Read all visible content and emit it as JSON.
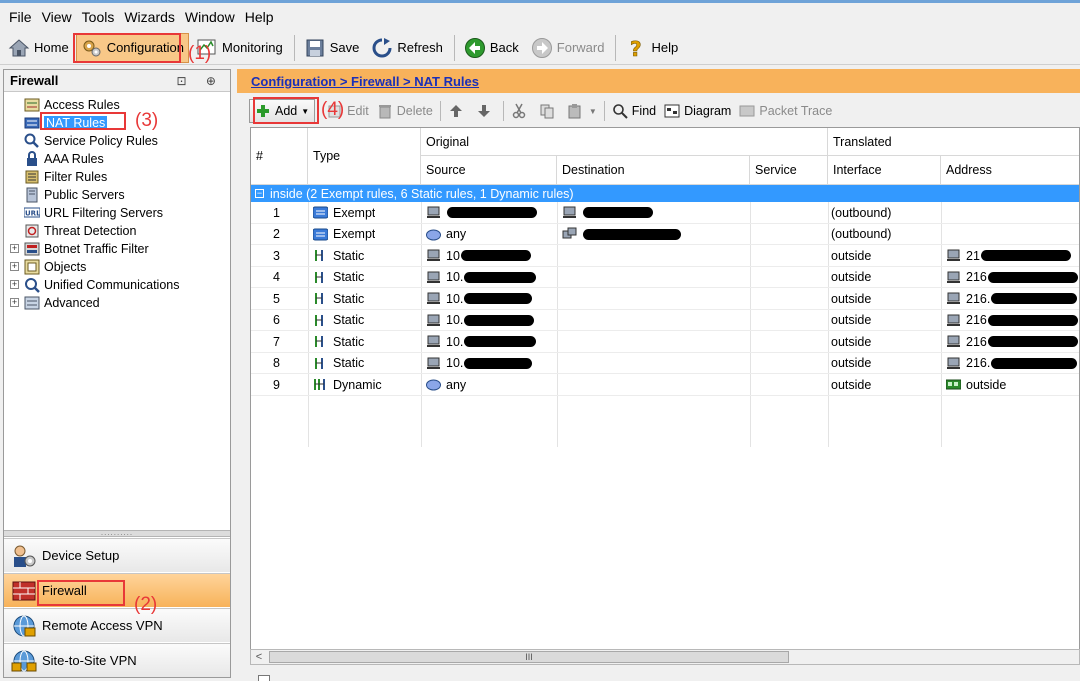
{
  "menu": [
    "File",
    "View",
    "Tools",
    "Wizards",
    "Window",
    "Help"
  ],
  "toolbar": {
    "home": "Home",
    "configuration": "Configuration",
    "monitoring": "Monitoring",
    "save": "Save",
    "refresh": "Refresh",
    "back": "Back",
    "forward": "Forward",
    "help": "Help"
  },
  "callouts": {
    "c1": "(1)",
    "c2": "(2)",
    "c3": "(3)",
    "c4": "(4)"
  },
  "left_panel": {
    "title": "Firewall",
    "header_icons": "⊡ ⊕",
    "tree": [
      {
        "label": "Access Rules",
        "icon": "access-rules-icon"
      },
      {
        "label": "NAT Rules",
        "icon": "nat-rules-icon",
        "selected": true
      },
      {
        "label": "Service Policy Rules",
        "icon": "service-policy-icon"
      },
      {
        "label": "AAA Rules",
        "icon": "aaa-rules-icon"
      },
      {
        "label": "Filter Rules",
        "icon": "filter-rules-icon"
      },
      {
        "label": "Public Servers",
        "icon": "public-servers-icon"
      },
      {
        "label": "URL Filtering Servers",
        "icon": "url-filtering-icon"
      },
      {
        "label": "Threat Detection",
        "icon": "threat-detection-icon"
      },
      {
        "label": "Botnet Traffic Filter",
        "icon": "botnet-icon",
        "expandable": true
      },
      {
        "label": "Objects",
        "icon": "objects-icon",
        "expandable": true
      },
      {
        "label": "Unified Communications",
        "icon": "unified-comm-icon",
        "expandable": true
      },
      {
        "label": "Advanced",
        "icon": "advanced-icon",
        "expandable": true
      }
    ],
    "nav": [
      {
        "label": "Device Setup"
      },
      {
        "label": "Firewall",
        "active": true
      },
      {
        "label": "Remote Access VPN"
      },
      {
        "label": "Site-to-Site VPN"
      }
    ]
  },
  "breadcrumb": "Configuration > Firewall > NAT Rules",
  "rtoolbar": {
    "add": "Add",
    "edit": "Edit",
    "delete": "Delete",
    "find": "Find",
    "diagram": "Diagram",
    "packet_trace": "Packet Trace"
  },
  "table": {
    "headers": {
      "num": "#",
      "type": "Type",
      "original": "Original",
      "translated": "Translated",
      "source": "Source",
      "destination": "Destination",
      "service": "Service",
      "interface": "Interface",
      "address": "Address"
    },
    "group": "inside (2 Exempt rules, 6 Static rules, 1 Dynamic rules)",
    "rows": [
      {
        "num": "1",
        "type": "Exempt",
        "source": "",
        "destination": "",
        "interface": "(outbound)",
        "address": ""
      },
      {
        "num": "2",
        "type": "Exempt",
        "source": "any",
        "destination": "",
        "interface": "(outbound)",
        "address": ""
      },
      {
        "num": "3",
        "type": "Static",
        "source": "10",
        "destination": "",
        "interface": "outside",
        "address": "21"
      },
      {
        "num": "4",
        "type": "Static",
        "source": "10.",
        "destination": "",
        "interface": "outside",
        "address": "216"
      },
      {
        "num": "5",
        "type": "Static",
        "source": "10.",
        "destination": "",
        "interface": "outside",
        "address": "216."
      },
      {
        "num": "6",
        "type": "Static",
        "source": "10.",
        "destination": "",
        "interface": "outside",
        "address": "216"
      },
      {
        "num": "7",
        "type": "Static",
        "source": "10.",
        "destination": "",
        "interface": "outside",
        "address": "216"
      },
      {
        "num": "8",
        "type": "Static",
        "source": "10.",
        "destination": "",
        "interface": "outside",
        "address": "216."
      },
      {
        "num": "9",
        "type": "Dynamic",
        "source": "any",
        "destination": "",
        "interface": "outside",
        "address": "outside"
      }
    ]
  },
  "scroll_grip": "III",
  "colors": {
    "accent_orange": "#f8b25b",
    "selection_blue": "#3399ff",
    "annotation_red": "#e83838",
    "breadcrumb_blue": "#1a2fb8"
  }
}
